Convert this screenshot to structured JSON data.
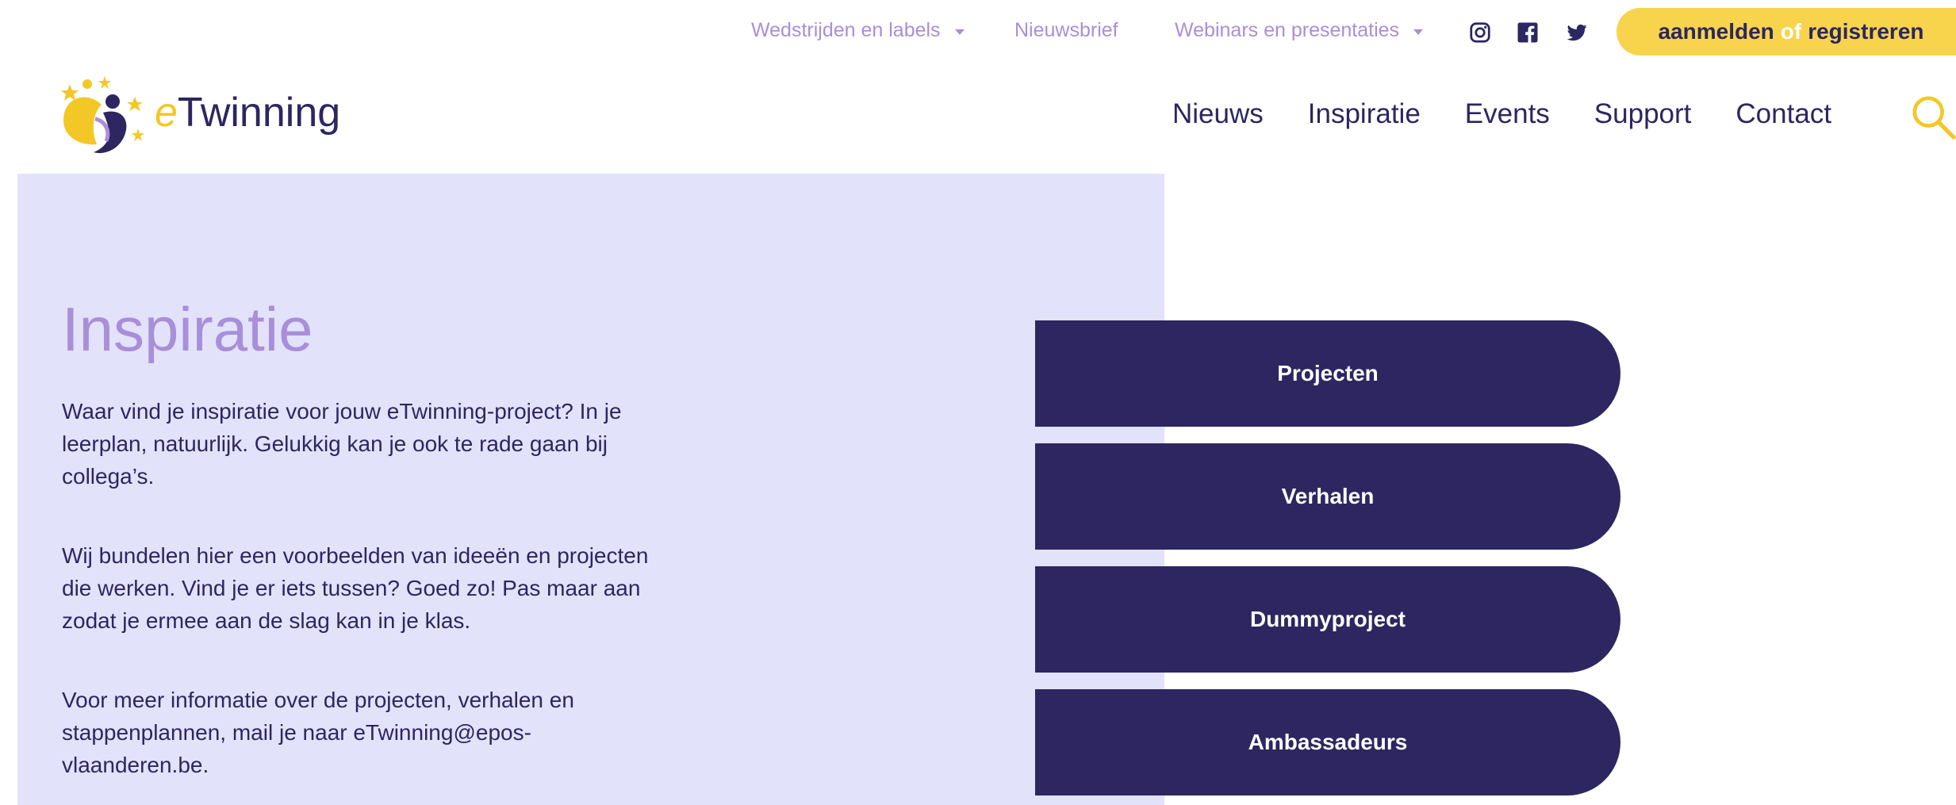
{
  "topbar": {
    "links": [
      {
        "label": "Wedstrijden en labels",
        "has_caret": true
      },
      {
        "label": "Nieuwsbrief",
        "has_caret": false
      },
      {
        "label": "Webinars en presentaties",
        "has_caret": true
      }
    ],
    "social": [
      "instagram-icon",
      "facebook-icon",
      "twitter-icon"
    ],
    "cta": {
      "part1": "aanmelden",
      "part2": "of",
      "part3": "registreren"
    }
  },
  "header": {
    "logo": {
      "prefix": "e",
      "name": "Twinning"
    },
    "nav": [
      "Nieuws",
      "Inspiratie",
      "Events",
      "Support",
      "Contact"
    ],
    "search_icon": "search-icon"
  },
  "hero": {
    "title": "Inspiratie",
    "paragraphs": [
      "Waar vind je inspiratie voor jouw eTwinning-project? In je leerplan, natuurlijk. Gelukkig kan je ook te rade gaan bij collega’s.",
      "Wij bundelen hier een voorbeelden van ideeën en projecten die werken. Vind je er iets tussen? Goed zo! Pas maar aan zodat je ermee aan de slag kan in je klas.",
      "Voor meer informatie over de projecten, verhalen en stappenplannen, mail je naar eTwinning@epos-vlaanderen.be."
    ],
    "buttons": [
      "Projecten",
      "Verhalen",
      "Dummyproject",
      "Ambassadeurs"
    ]
  },
  "colors": {
    "navy": "#2d2660",
    "lavender": "#a88fd9",
    "panel": "#e3e2fb",
    "yellow": "#f7d44c"
  }
}
